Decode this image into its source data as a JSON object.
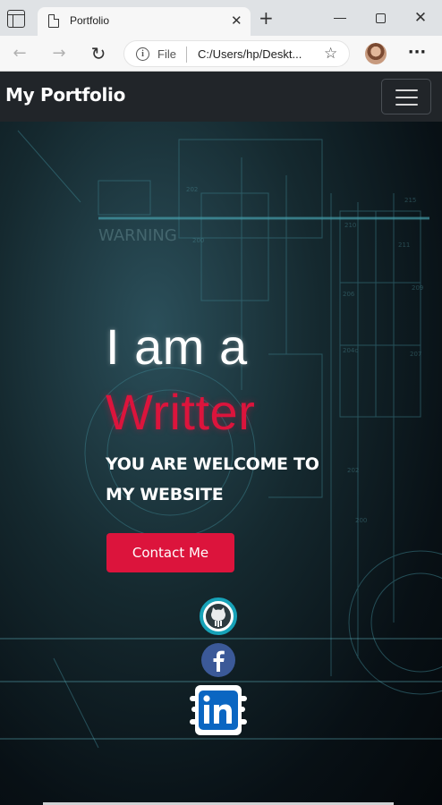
{
  "browser": {
    "tab_title": "Portfolio",
    "tab_close": "✕",
    "new_tab": "+",
    "window_close": "✕",
    "scheme_label": "File",
    "url": "C:/Users/hp/Deskt...",
    "back_icon": "←",
    "forward_icon": "→",
    "reload_icon": "↻",
    "info_icon": "i",
    "favorite_icon": "☆",
    "more_icon": "···"
  },
  "navbar": {
    "brand": "My Portfolio"
  },
  "hero": {
    "line1": "I am a",
    "line2": "Writter",
    "welcome": "YOU ARE WELCOME TO MY WEBSITE",
    "contact_label": "Contact Me"
  },
  "colors": {
    "accent": "#dc143c",
    "navbar_bg": "#212529",
    "github_ring": "#17a2b8",
    "facebook": "#3b5998",
    "linkedin": "#0a66c2"
  },
  "icons": {
    "github": "github-icon",
    "facebook": "facebook-icon",
    "linkedin": "linkedin-icon",
    "menu": "hamburger-icon"
  }
}
